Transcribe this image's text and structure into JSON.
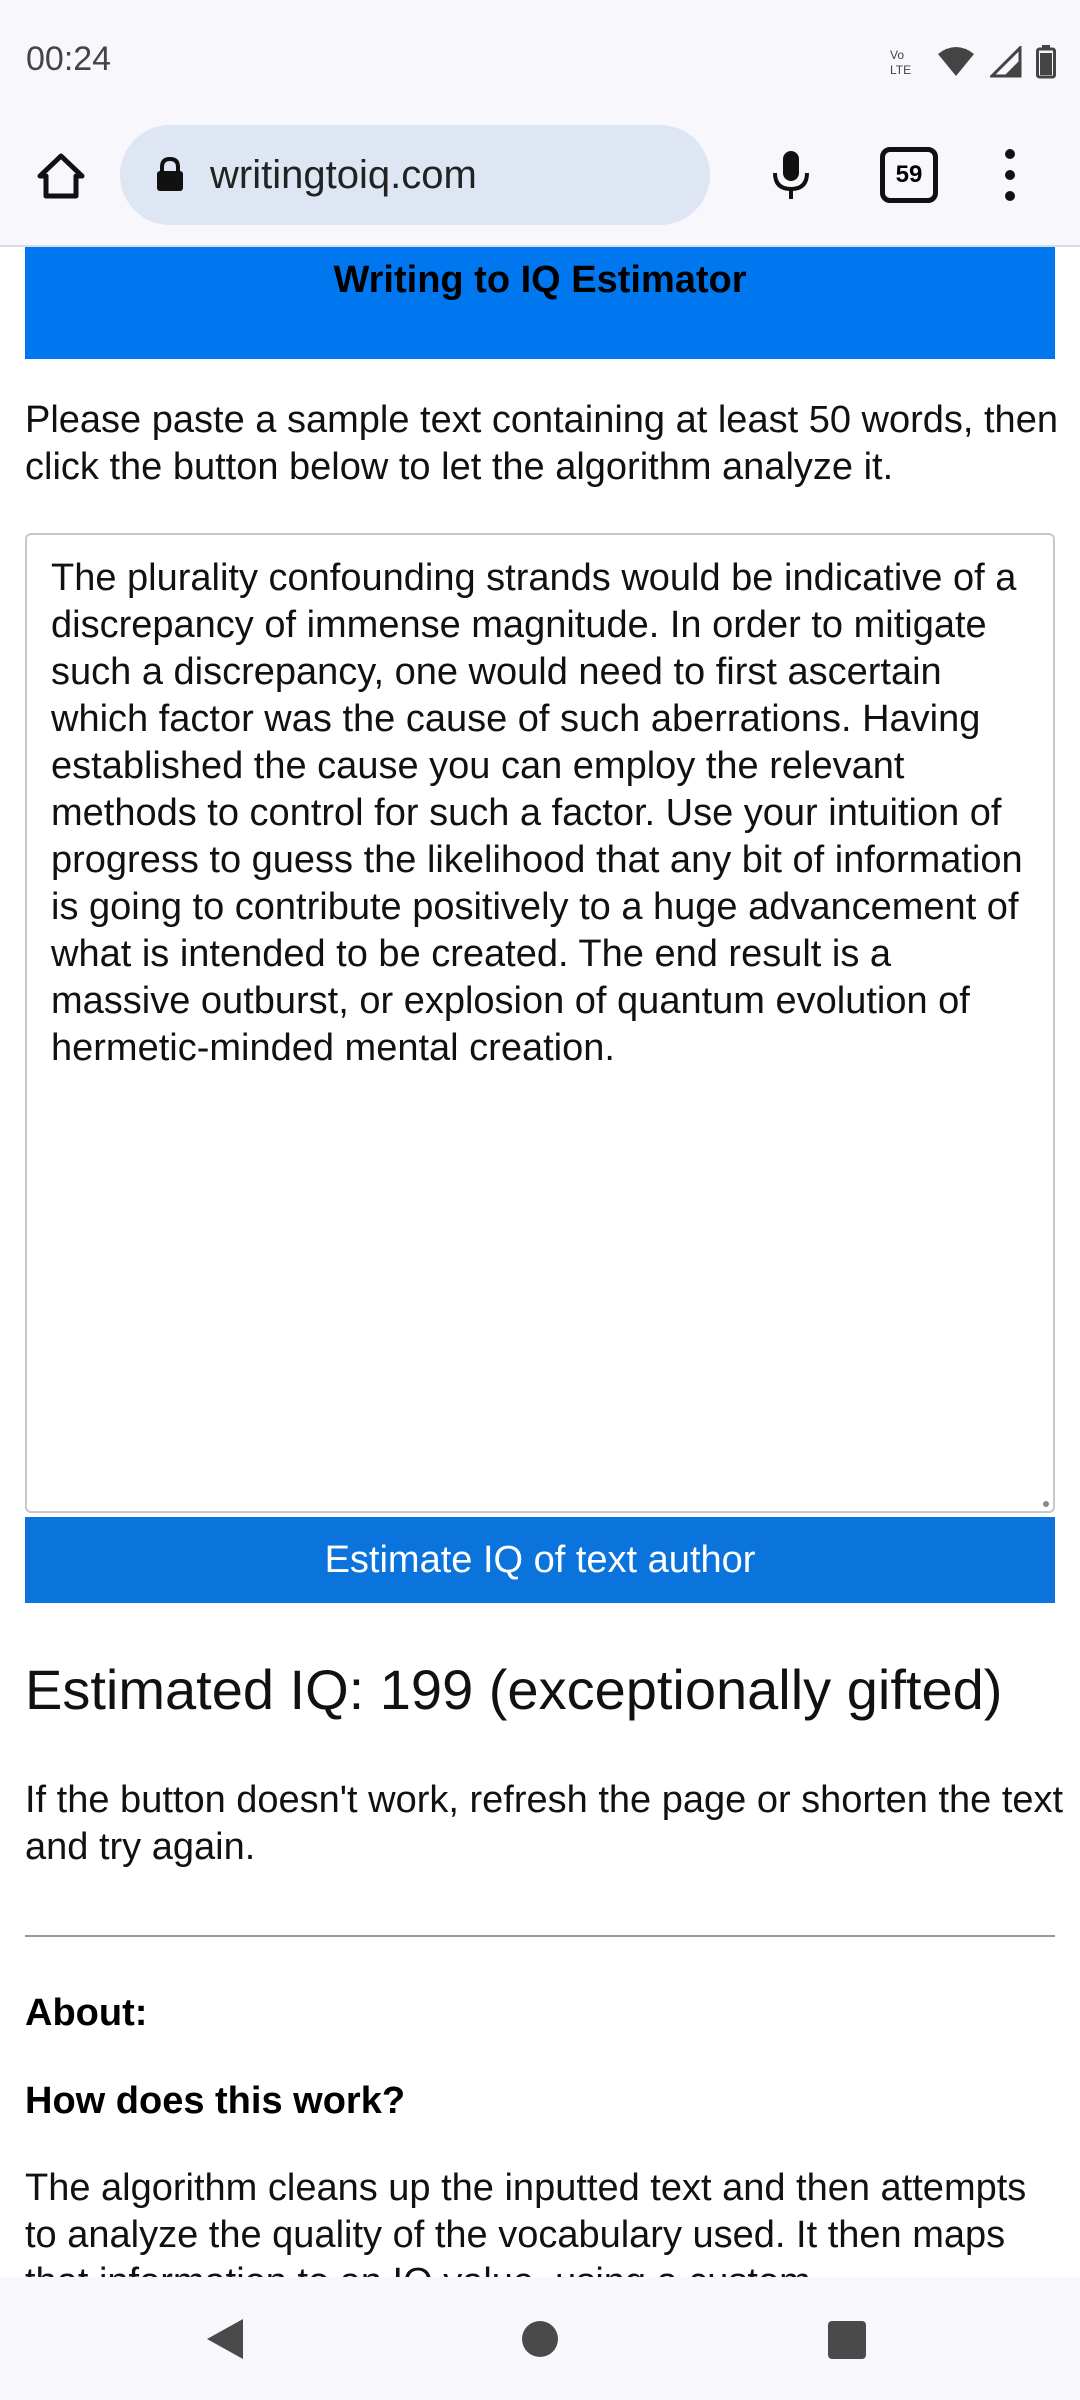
{
  "status_bar": {
    "time": "00:24",
    "icons": [
      "volte-icon",
      "wifi-icon",
      "signal-icon",
      "battery-icon"
    ],
    "volte_label": "Vo LTE"
  },
  "browser": {
    "url": "writingtoiq.com",
    "tab_count": "59",
    "icons": [
      "home-icon",
      "lock-icon",
      "mic-icon",
      "tabs-icon",
      "more-icon"
    ]
  },
  "page": {
    "banner_title": "Writing to IQ Estimator",
    "intro": "Please paste a sample text containing at least 50 words, then click the button below to let the algorithm analyze it.",
    "textarea_value": "The plurality confounding strands would be indicative of a discrepancy of immense magnitude. In order to mitigate such a discrepancy, one would need to first ascertain which factor was the cause of such aberrations. Having established the cause you can employ the relevant methods to control for such a factor. Use your intuition of progress to guess the likelihood that any bit of information is going to contribute positively to a huge advancement of what is intended to be created. The end result is a massive outburst, or explosion of quantum evolution of hermetic-minded mental creation.",
    "estimate_button": "Estimate IQ of text author",
    "result": "Estimated IQ: 199 (exceptionally gifted)",
    "hint": "If the button doesn't work, refresh the page or shorten the text and try again.",
    "about_heading": "About:",
    "how_heading": "How does this work?",
    "algorithm_text": "The algorithm cleans up the inputted text and then attempts to analyze the quality of the vocabulary used. It then maps that information to an IQ value, using a custom"
  },
  "colors": {
    "banner": "#0077ee",
    "button": "#0a74dc",
    "chrome_bg": "#f8f8fc",
    "url_bar": "#dde6f2"
  },
  "nav_bar": {
    "icons": [
      "back-icon",
      "home-circle-icon",
      "recents-icon"
    ]
  }
}
